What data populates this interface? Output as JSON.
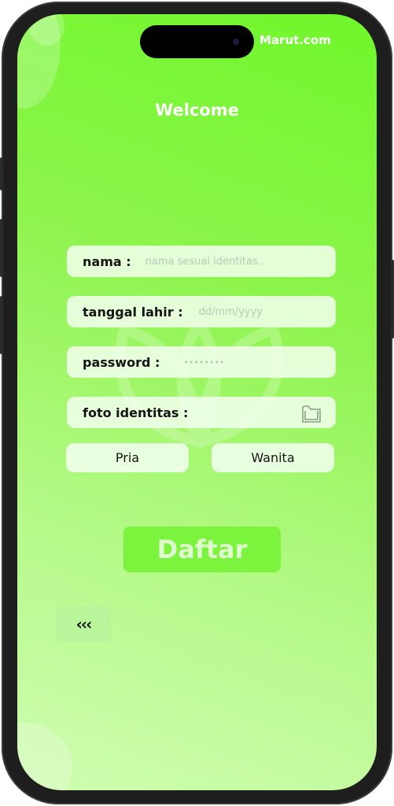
{
  "header": {
    "brand": "Marut.com",
    "welcome": "Welcome"
  },
  "form": {
    "nama": {
      "label": "nama  :",
      "placeholder": "nama sesuai identitas.."
    },
    "tanggal_lahir": {
      "label": "tanggal lahir :",
      "placeholder": "dd/mm/yyyy"
    },
    "password": {
      "label": "password :",
      "placeholder": "••••••••"
    },
    "foto_identitas": {
      "label": "foto identitas :"
    }
  },
  "gender": {
    "pria": "Pria",
    "wanita": "Wanita"
  },
  "submit_label": "Daftar",
  "back_label": "‹‹‹",
  "colors": {
    "accent": "#7cf43e",
    "background_top": "#6ff72a",
    "background_bottom": "#cffcb2"
  },
  "icons": {
    "upload": "folder-icon",
    "back": "triple-chevron-left-icon"
  }
}
